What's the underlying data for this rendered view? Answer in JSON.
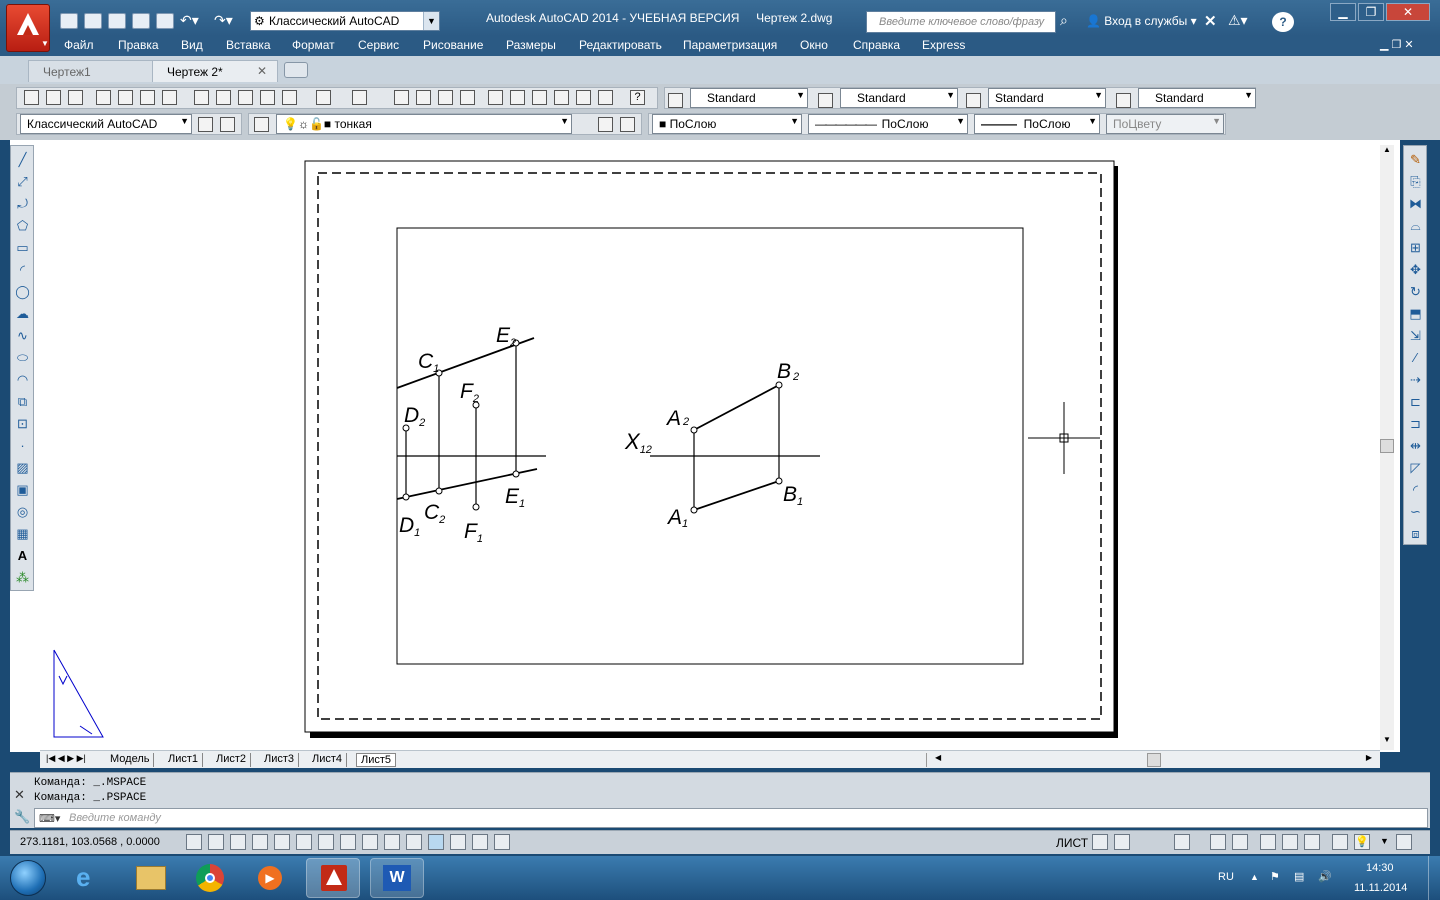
{
  "title_bar": {
    "workspace": "Классический AutoCAD",
    "app_title": "Autodesk AutoCAD 2014 - УЧЕБНАЯ ВЕРСИЯ",
    "file_name": "Чертеж 2.dwg",
    "search_placeholder": "Введите ключевое слово/фразу",
    "signin": "Вход в службы",
    "help": "?"
  },
  "menu": [
    "Файл",
    "Правка",
    "Вид",
    "Вставка",
    "Формат",
    "Сервис",
    "Рисование",
    "Размеры",
    "Редактировать",
    "Параметризация",
    "Окно",
    "Справка",
    "Express"
  ],
  "doc_tabs": [
    {
      "label": "Чертеж1"
    },
    {
      "label": "Чертеж 2*"
    }
  ],
  "styles_toolbar": {
    "text_style": "Standard",
    "dim_style": "Standard",
    "table_style": "Standard",
    "mleader_style": "Standard"
  },
  "layers_toolbar": {
    "workspace": "Классический AutoCAD",
    "layer": "тонкая",
    "color": "ПоСлою",
    "linetype": "ПоСлою",
    "lineweight": "ПоСлою",
    "plotstyle": "ПоЦвету"
  },
  "layout_tabs": [
    "Модель",
    "Лист1",
    "Лист2",
    "Лист3",
    "Лист4",
    "Лист5"
  ],
  "command": {
    "line1": "Команда:  _.MSPACE",
    "line2": "Команда:  _.PSPACE",
    "placeholder": "Введите команду"
  },
  "status": {
    "coords": "273.1181, 103.0568 , 0.0000",
    "space": "ЛИСТ"
  },
  "taskbar": {
    "lang": "RU",
    "time": "14:30",
    "date": "11.11.2014"
  },
  "drawing": {
    "labels": {
      "C1": {
        "l": "C",
        "s": "1"
      },
      "E2": {
        "l": "E",
        "s": "2"
      },
      "F2": {
        "l": "F",
        "s": "2"
      },
      "D2": {
        "l": "D",
        "s": "2"
      },
      "D1": {
        "l": "D",
        "s": "1"
      },
      "C2": {
        "l": "C",
        "s": "2"
      },
      "F1": {
        "l": "F",
        "s": "1"
      },
      "E1": {
        "l": "E",
        "s": "1"
      },
      "X12": {
        "l": "X",
        "s": "12"
      },
      "A2": {
        "l": "A",
        "s": "2"
      },
      "B2": {
        "l": "B",
        "s": "2"
      },
      "A1": {
        "l": "A",
        "s": "1"
      },
      "B1": {
        "l": "B",
        "s": "1"
      }
    }
  },
  "colors": {
    "title_bar": "#2b5a84",
    "accent": "#c22a16",
    "taskbar": "#1d4f7c"
  }
}
